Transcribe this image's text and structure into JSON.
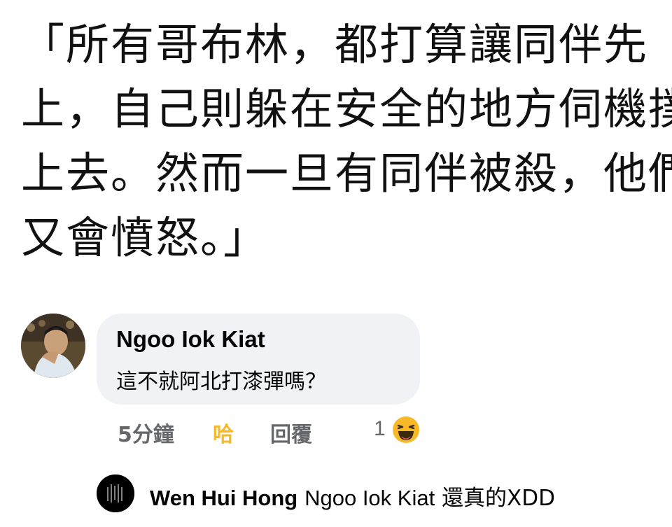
{
  "quote": {
    "lines": [
      "「所有哥布林，都打算讓同伴先",
      "上，自己則躲在安全的地方伺機撲",
      "上去。然而一旦有同伴被殺，他們",
      "又會憤怒。」"
    ]
  },
  "comment": {
    "author": "Ngoo Iok Kiat",
    "text": "這不就阿北打漆彈嗎？",
    "time": "5分鐘",
    "haha_label": "哈",
    "reply_label": "回覆",
    "reaction_count": "1",
    "reaction_icon": "laughing-emoji-icon"
  },
  "reply": {
    "author": "Wen Hui Hong",
    "mention": "Ngoo Iok Kiat",
    "text": "還真的XDD"
  },
  "colors": {
    "bubble": "#f0f2f5",
    "meta": "#65676b",
    "haha": "#f7b928"
  }
}
